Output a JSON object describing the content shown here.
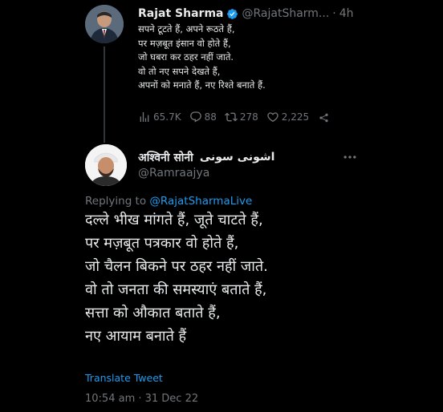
{
  "colors": {
    "background": "#000000",
    "text_primary": "#e7e9ea",
    "text_secondary": "#71767b",
    "accent": "#1d9bf0",
    "divider": "#333639"
  },
  "parent_tweet": {
    "author_name": "Rajat Sharma",
    "verified_icon": "verified-badge-icon",
    "handle": "@RajatSharm...",
    "separator": "·",
    "time": "4h",
    "lines": [
      "सपने टूटते हैं, अपने रूठते हैं,",
      "पर मज़बूत इंसान वो होते हैं,",
      "जो घबरा कर ठहर नहीं जाते.",
      "वो तो नए सपने देखते हैं,",
      "अपनों को मनाते हैं, नए रिश्ते बनाते हैं."
    ],
    "actions": {
      "views": "65.7K",
      "replies": "88",
      "retweets": "278",
      "likes": "2,225"
    }
  },
  "reply_tweet": {
    "author_name": "अश्विनी सोनी",
    "author_name_urdu": "اشونی سونی",
    "handle": "@Ramraajya",
    "more_icon": "more-options-icon",
    "replying_prefix": "Replying to",
    "replying_to": "@RajatSharmaLive",
    "lines": [
      "दल्ले भीख मांगते हैं, जूते चाटते हैं,",
      "पर मज़बूत पत्रकार वो होते हैं,",
      "जो चैलन बिकने पर ठहर नहीं जाते.",
      "वो तो जनता की समस्याएं बताते हैं,",
      "सत्ता को औकात बताते हैं,",
      "नए आयाम बनाते हैं"
    ],
    "translate_label": "Translate Tweet",
    "timestamp": "10:54 am · 31 Dec 22"
  }
}
